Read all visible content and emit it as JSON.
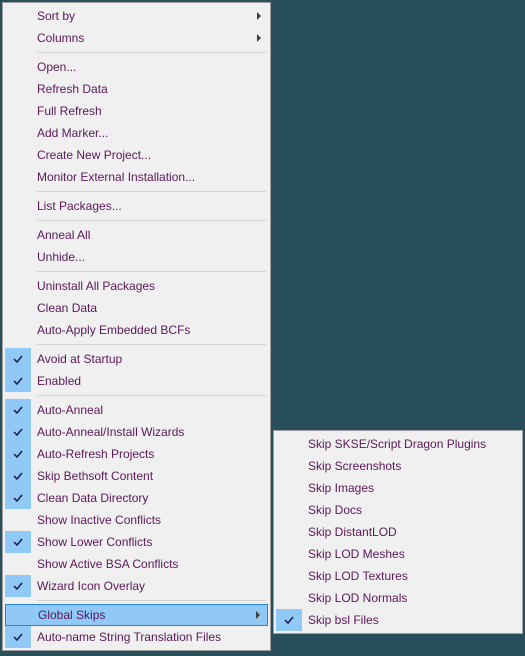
{
  "main_menu": {
    "groups": [
      [
        {
          "label": "Sort by",
          "submenu": true
        },
        {
          "label": "Columns",
          "submenu": true
        }
      ],
      [
        {
          "label": "Open..."
        },
        {
          "label": "Refresh Data"
        },
        {
          "label": "Full Refresh"
        },
        {
          "label": "Add Marker..."
        },
        {
          "label": "Create New Project..."
        },
        {
          "label": "Monitor External Installation..."
        }
      ],
      [
        {
          "label": "List Packages..."
        }
      ],
      [
        {
          "label": "Anneal All"
        },
        {
          "label": "Unhide..."
        }
      ],
      [
        {
          "label": "Uninstall All Packages"
        },
        {
          "label": "Clean Data"
        },
        {
          "label": "Auto-Apply Embedded BCFs"
        }
      ],
      [
        {
          "label": "Avoid at Startup",
          "checked": true
        },
        {
          "label": "Enabled",
          "checked": true
        }
      ],
      [
        {
          "label": "Auto-Anneal",
          "checked": true
        },
        {
          "label": "Auto-Anneal/Install Wizards",
          "checked": true
        },
        {
          "label": "Auto-Refresh Projects",
          "checked": true
        },
        {
          "label": "Skip Bethsoft Content",
          "checked": true
        },
        {
          "label": "Clean Data Directory",
          "checked": true
        },
        {
          "label": "Show Inactive Conflicts"
        },
        {
          "label": "Show Lower Conflicts",
          "checked": true
        },
        {
          "label": "Show Active BSA Conflicts"
        },
        {
          "label": "Wizard Icon Overlay",
          "checked": true
        }
      ],
      [
        {
          "label": "Global Skips",
          "submenu": true,
          "selected": true
        },
        {
          "label": "Auto-name String Translation Files",
          "checked": true
        }
      ]
    ]
  },
  "sub_menu": {
    "items": [
      {
        "label": "Skip SKSE/Script Dragon Plugins"
      },
      {
        "label": "Skip Screenshots"
      },
      {
        "label": "Skip Images"
      },
      {
        "label": "Skip Docs"
      },
      {
        "label": "Skip DistantLOD"
      },
      {
        "label": "Skip LOD Meshes"
      },
      {
        "label": "Skip LOD Textures"
      },
      {
        "label": "Skip LOD Normals"
      },
      {
        "label": "Skip bsl Files",
        "checked": true
      }
    ]
  }
}
